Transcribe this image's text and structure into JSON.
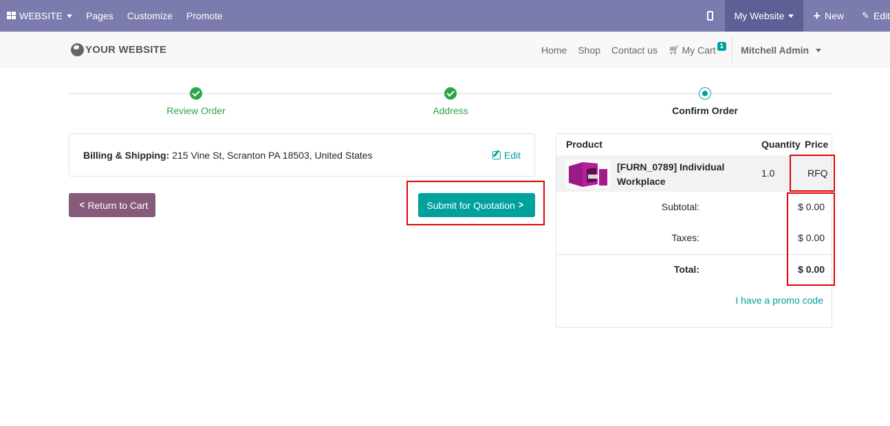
{
  "topbar": {
    "brand": "WEBSITE",
    "menu": [
      "Pages",
      "Customize",
      "Promote"
    ],
    "site_selector": "My Website",
    "new_label": "New",
    "edit_label": "Edit"
  },
  "header": {
    "logo_text": "YOUR WEBSITE",
    "nav": [
      "Home",
      "Shop",
      "Contact us"
    ],
    "cart_label": "My Cart",
    "cart_count": "1",
    "user": "Mitchell Admin"
  },
  "wizard": {
    "steps": [
      {
        "label": "Review Order",
        "state": "done"
      },
      {
        "label": "Address",
        "state": "done"
      },
      {
        "label": "Confirm Order",
        "state": "current"
      }
    ]
  },
  "billing": {
    "label": "Billing & Shipping:",
    "address": "215 Vine St, Scranton PA 18503, United States",
    "edit_label": "Edit"
  },
  "buttons": {
    "return_label": "Return to Cart",
    "submit_label": "Submit for Quotation"
  },
  "summary": {
    "columns": [
      "Product",
      "Quantity",
      "Price"
    ],
    "item": {
      "name": "[FURN_0789] Individual Workplace",
      "quantity": "1.0",
      "price": "RFQ"
    },
    "subtotal_label": "Subtotal:",
    "subtotal_value": "$ 0.00",
    "taxes_label": "Taxes:",
    "taxes_value": "$ 0.00",
    "total_label": "Total:",
    "total_value": "$ 0.00",
    "promo_label": "I have a promo code"
  },
  "colors": {
    "admin_bar": "#7c7bad",
    "primary": "#00a09d",
    "secondary": "#875a7b",
    "success": "#28a745",
    "highlight": "#e00000"
  }
}
